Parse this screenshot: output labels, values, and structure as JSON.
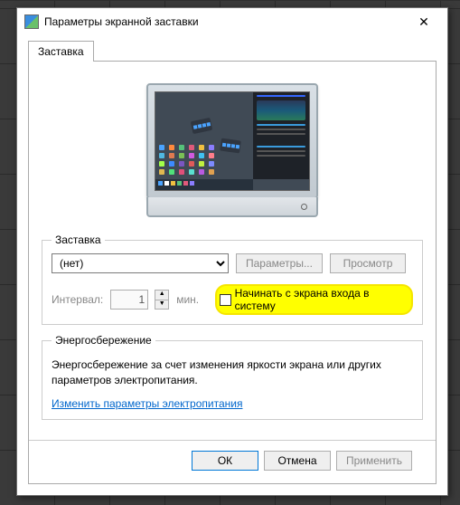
{
  "window": {
    "title": "Параметры экранной заставки",
    "close_glyph": "✕"
  },
  "tab": {
    "label": "Заставка"
  },
  "screensaver": {
    "legend": "Заставка",
    "selected": "(нет)",
    "settings_btn": "Параметры...",
    "preview_btn": "Просмотр",
    "interval_label": "Интервал:",
    "interval_value": "1",
    "interval_unit": "мин.",
    "resume_label": "Начинать с экрана входа в систему"
  },
  "energy": {
    "legend": "Энергосбережение",
    "text": "Энергосбережение за счет изменения яркости экрана или других параметров электропитания.",
    "link": "Изменить параметры электропитания"
  },
  "buttons": {
    "ok": "ОК",
    "cancel": "Отмена",
    "apply": "Применить"
  },
  "icon_colors": [
    "#4aa3ff",
    "#ff8a3d",
    "#56c27a",
    "#e05a7a",
    "#f0c040",
    "#8a7dff",
    "#50b8e0",
    "#e07a50",
    "#7ac056",
    "#d05ae0",
    "#40c0f0",
    "#ff7d8a",
    "#a3ff4a",
    "#3d8aff",
    "#7a56c2",
    "#e05a5a",
    "#c0f040",
    "#7d8aff",
    "#e0b850",
    "#50e07a",
    "#e0507a",
    "#5ae0d0",
    "#b85ae0",
    "#e0a050"
  ],
  "tb_colors": [
    "#4aa3ff",
    "#ffffff",
    "#f0c040",
    "#56c27a",
    "#e05a7a",
    "#8a7dff"
  ]
}
